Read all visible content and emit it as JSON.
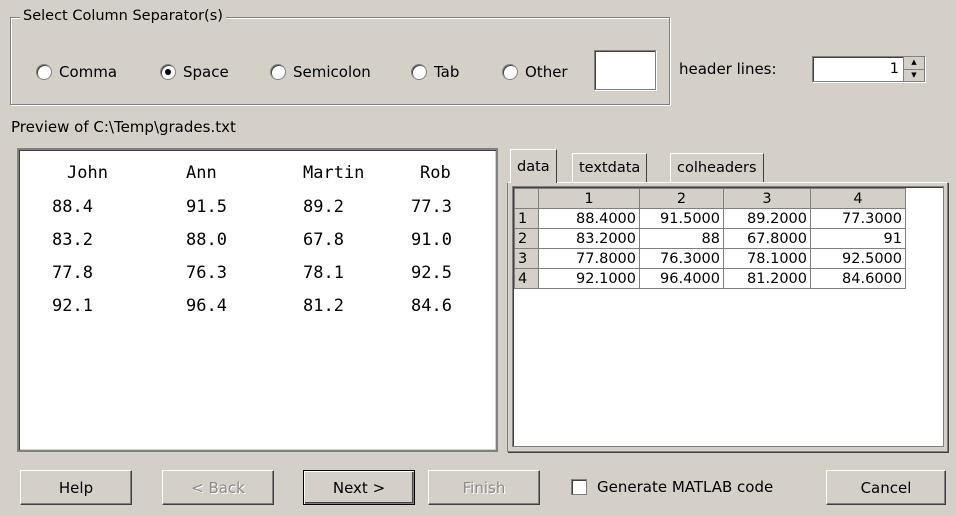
{
  "separators": {
    "legend": "Select Column Separator(s)",
    "options": [
      {
        "label": "Comma",
        "checked": false
      },
      {
        "label": "Space",
        "checked": true
      },
      {
        "label": "Semicolon",
        "checked": false
      },
      {
        "label": "Tab",
        "checked": false
      },
      {
        "label": "Other",
        "checked": false
      }
    ],
    "other_value": ""
  },
  "header_lines": {
    "label": "header lines:",
    "value": "1"
  },
  "preview": {
    "label": "Preview of C:\\Temp\\grades.txt",
    "rows": [
      [
        "John",
        "Ann",
        "Martin",
        "Rob"
      ],
      [
        "88.4",
        "91.5",
        "89.2",
        "77.3"
      ],
      [
        "83.2",
        "88.0",
        "67.8",
        "91.0"
      ],
      [
        "77.8",
        "76.3",
        "78.1",
        "92.5"
      ],
      [
        "92.1",
        "96.4",
        "81.2",
        "84.6"
      ]
    ]
  },
  "tabs": [
    {
      "label": "data",
      "active": true
    },
    {
      "label": "textdata",
      "active": false
    },
    {
      "label": "colheaders",
      "active": false
    }
  ],
  "grid": {
    "columns": [
      "1",
      "2",
      "3",
      "4"
    ],
    "rows": [
      {
        "hdr": "1",
        "cells": [
          "88.4000",
          "91.5000",
          "89.2000",
          "77.3000"
        ]
      },
      {
        "hdr": "2",
        "cells": [
          "83.2000",
          "88",
          "67.8000",
          "91"
        ]
      },
      {
        "hdr": "3",
        "cells": [
          "77.8000",
          "76.3000",
          "78.1000",
          "92.5000"
        ]
      },
      {
        "hdr": "4",
        "cells": [
          "92.1000",
          "96.4000",
          "81.2000",
          "84.6000"
        ]
      }
    ]
  },
  "buttons": {
    "help": "Help",
    "back": "< Back",
    "next": "Next >",
    "finish": "Finish",
    "cancel": "Cancel"
  },
  "generate_code": {
    "label": "Generate MATLAB code",
    "checked": false
  }
}
